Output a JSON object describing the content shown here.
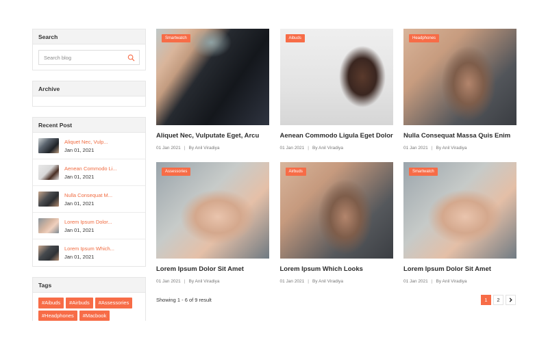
{
  "sidebar": {
    "search": {
      "title": "Search",
      "placeholder": "Search blog"
    },
    "archive": {
      "title": "Archive"
    },
    "recent": {
      "title": "Recent Post",
      "items": [
        {
          "title": "Aliquet Nec, Vulp...",
          "date": "Jan 01, 2021"
        },
        {
          "title": "Aenean Commodo Li...",
          "date": "Jan 01, 2021"
        },
        {
          "title": "Nulla Consequat M...",
          "date": "Jan 01, 2021"
        },
        {
          "title": "Lorem Ipsum Dolor...",
          "date": "Jan 01, 2021"
        },
        {
          "title": "Lorem Ipsum Which...",
          "date": "Jan 01, 2021"
        }
      ]
    },
    "tags": {
      "title": "Tags",
      "items": [
        "#Aibuds",
        "#Airbuds",
        "#Assessories",
        "#Headphones",
        "#Macbook"
      ]
    }
  },
  "posts": [
    {
      "category": "Smartwatch",
      "title": "Aliquet Nec, Vulputate Eget, Arcu",
      "date": "01 Jan 2021",
      "author": "By Anil Viradiya"
    },
    {
      "category": "Aibuds",
      "title": "Aenean Commodo Ligula Eget Dolor",
      "date": "01 Jan 2021",
      "author": "By Anil Viradiya"
    },
    {
      "category": "Headphones",
      "title": "Nulla Consequat Massa Quis Enim",
      "date": "01 Jan 2021",
      "author": "By Anil Viradiya"
    },
    {
      "category": "Assessories",
      "title": "Lorem Ipsum Dolor Sit Amet",
      "date": "01 Jan 2021",
      "author": "By Anil Viradiya"
    },
    {
      "category": "Airbuds",
      "title": "Lorem Ipsum Which Looks",
      "date": "01 Jan 2021",
      "author": "By Anil Viradiya"
    },
    {
      "category": "Smartwatch",
      "title": "Lorem Ipsum Dolor Sit Amet",
      "date": "01 Jan 2021",
      "author": "By Anil Viradiya"
    }
  ],
  "footer": {
    "results_text": "Showing 1 - 6 of 9 result",
    "pages": [
      "1",
      "2"
    ],
    "active_page": "1",
    "next_icon": "chevron-right-icon"
  },
  "colors": {
    "accent": "#f76c47",
    "link": "#f06a3f"
  }
}
